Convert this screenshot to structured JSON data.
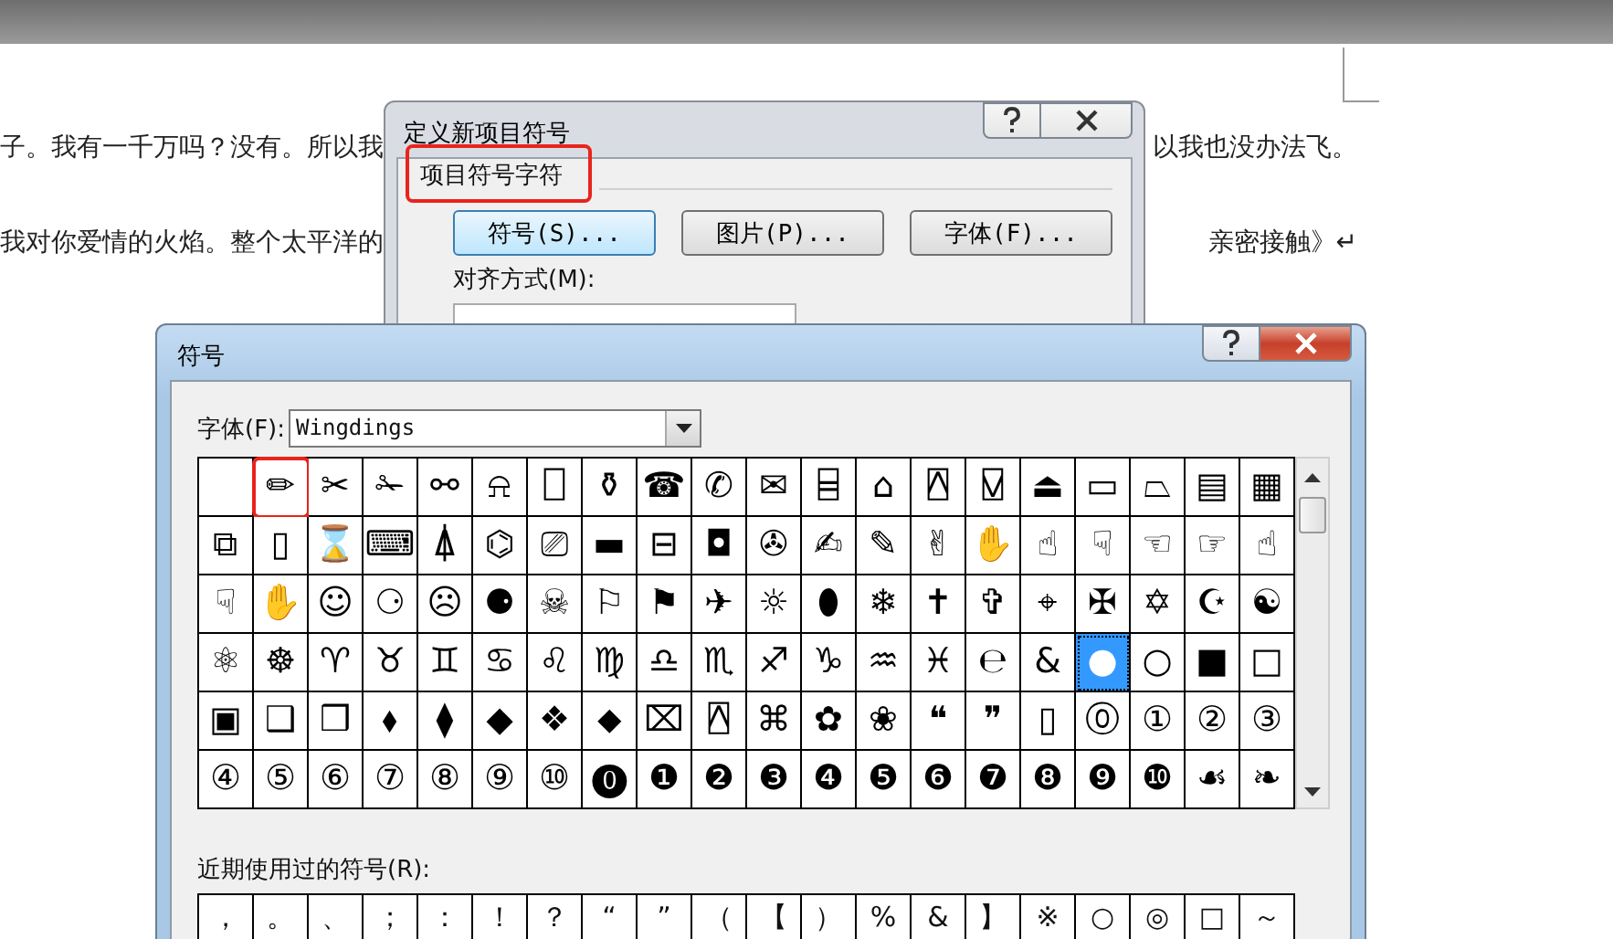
{
  "document": {
    "lines": [
      {
        "left": "子。我有一千万吗？没有。所以我",
        "right": "以我也没办法飞。"
      },
      {
        "left": "我对你爱情的火焰。整个太平洋的",
        "right": "亲密接触》↵"
      }
    ]
  },
  "bullet_dialog": {
    "title": "定义新项目符号",
    "group_label": "项目符号字符",
    "group_marked": true,
    "buttons": [
      "符号(S)...",
      "图片(P)...",
      "字体(F)..."
    ],
    "align_label": "对齐方式(M):"
  },
  "symbol_dialog": {
    "title": "符号",
    "font_label": "字体(F):",
    "font_value": "Wingdings",
    "rows": [
      [
        {
          "selected": false,
          "marked": false
        },
        {
          "s": "✏",
          "selected": false,
          "marked": true
        },
        {
          "s": "✂",
          "selected": false,
          "marked": false
        },
        {
          "s": "✁",
          "selected": false,
          "marked": false
        },
        {
          "s": "⚯",
          "selected": false,
          "marked": false
        },
        {
          "s": "⍾",
          "selected": false,
          "marked": false
        },
        {
          "s": "⎕",
          "selected": false,
          "marked": false
        },
        {
          "s": "⚱",
          "selected": false,
          "marked": false
        },
        {
          "s": "☎",
          "selected": false,
          "marked": false
        },
        {
          "s": "✆",
          "selected": false,
          "marked": false
        },
        {
          "s": "✉",
          "selected": false,
          "marked": false
        },
        {
          "s": "⌸",
          "selected": false,
          "marked": false
        },
        {
          "s": "⌂",
          "selected": false,
          "marked": false
        },
        {
          "s": "⍓",
          "selected": false,
          "marked": false
        },
        {
          "s": "⍌",
          "selected": false,
          "marked": false
        },
        {
          "s": "⏏",
          "selected": false,
          "marked": false
        },
        {
          "s": "▭",
          "selected": false,
          "marked": false
        },
        {
          "s": "⏢",
          "selected": false,
          "marked": false
        },
        {
          "s": "▤",
          "selected": false,
          "marked": false
        },
        {
          "s": "▦",
          "selected": false,
          "marked": false
        }
      ],
      [
        {
          "s": "⧉",
          "selected": false,
          "marked": false
        },
        {
          "s": "▯",
          "selected": false,
          "marked": false
        },
        {
          "s": "⌛",
          "selected": false,
          "marked": false
        },
        {
          "s": "⌨",
          "selected": false,
          "marked": false
        },
        {
          "s": "⍋",
          "selected": false,
          "marked": false
        },
        {
          "s": "⌬",
          "selected": false,
          "marked": false
        },
        {
          "s": "⎚",
          "selected": false,
          "marked": false
        },
        {
          "s": "▬",
          "selected": false,
          "marked": false
        },
        {
          "s": "⊟",
          "selected": false,
          "marked": false
        },
        {
          "s": "◘",
          "selected": false,
          "marked": false
        },
        {
          "s": "✇",
          "selected": false,
          "marked": false
        },
        {
          "s": "✍",
          "selected": false,
          "marked": false
        },
        {
          "s": "✎",
          "selected": false,
          "marked": false
        },
        {
          "s": "✌",
          "selected": false,
          "marked": false
        },
        {
          "s": "✋",
          "selected": false,
          "marked": false
        },
        {
          "s": "☝",
          "selected": false,
          "marked": false
        },
        {
          "s": "☟",
          "selected": false,
          "marked": false
        },
        {
          "s": "☜",
          "selected": false,
          "marked": false
        },
        {
          "s": "☞",
          "selected": false,
          "marked": false
        },
        {
          "s": "☝",
          "selected": false,
          "marked": false
        }
      ],
      [
        {
          "s": "☟",
          "selected": false,
          "marked": false
        },
        {
          "s": "✋",
          "selected": false,
          "marked": false
        },
        {
          "s": "☺",
          "selected": false,
          "marked": false
        },
        {
          "s": "⚆",
          "selected": false,
          "marked": false
        },
        {
          "s": "☹",
          "selected": false,
          "marked": false
        },
        {
          "s": "⚈",
          "selected": false,
          "marked": false
        },
        {
          "s": "☠",
          "selected": false,
          "marked": false
        },
        {
          "s": "⚐",
          "selected": false,
          "marked": false
        },
        {
          "s": "⚑",
          "selected": false,
          "marked": false
        },
        {
          "s": "✈",
          "selected": false,
          "marked": false
        },
        {
          "s": "☼",
          "selected": false,
          "marked": false
        },
        {
          "s": "⬮",
          "selected": false,
          "marked": false
        },
        {
          "s": "❄",
          "selected": false,
          "marked": false
        },
        {
          "s": "✝",
          "selected": false,
          "marked": false
        },
        {
          "s": "✞",
          "selected": false,
          "marked": false
        },
        {
          "s": "⌖",
          "selected": false,
          "marked": false
        },
        {
          "s": "✠",
          "selected": false,
          "marked": false
        },
        {
          "s": "✡",
          "selected": false,
          "marked": false
        },
        {
          "s": "☪",
          "selected": false,
          "marked": false
        },
        {
          "s": "☯",
          "selected": false,
          "marked": false
        }
      ],
      [
        {
          "s": "⚛",
          "selected": false,
          "marked": false
        },
        {
          "s": "☸",
          "selected": false,
          "marked": false
        },
        {
          "s": "♈",
          "selected": false,
          "marked": false
        },
        {
          "s": "♉",
          "selected": false,
          "marked": false
        },
        {
          "s": "♊",
          "selected": false,
          "marked": false
        },
        {
          "s": "♋",
          "selected": false,
          "marked": false
        },
        {
          "s": "♌",
          "selected": false,
          "marked": false
        },
        {
          "s": "♍",
          "selected": false,
          "marked": false
        },
        {
          "s": "♎",
          "selected": false,
          "marked": false
        },
        {
          "s": "♏",
          "selected": false,
          "marked": false
        },
        {
          "s": "♐",
          "selected": false,
          "marked": false
        },
        {
          "s": "♑",
          "selected": false,
          "marked": false
        },
        {
          "s": "♒",
          "selected": false,
          "marked": false
        },
        {
          "s": "♓",
          "selected": false,
          "marked": false
        },
        {
          "s": "℮",
          "selected": false,
          "marked": false
        },
        {
          "s": "&",
          "selected": false,
          "marked": false
        },
        {
          "s": "●",
          "selected": true,
          "marked": false
        },
        {
          "s": "○",
          "selected": false,
          "marked": false
        },
        {
          "s": "■",
          "selected": false,
          "marked": false
        },
        {
          "s": "□",
          "selected": false,
          "marked": false
        }
      ],
      [
        {
          "s": "▣",
          "selected": false,
          "marked": false
        },
        {
          "s": "❑",
          "selected": false,
          "marked": false
        },
        {
          "s": "❒",
          "selected": false,
          "marked": false
        },
        {
          "s": "⬧",
          "selected": false,
          "marked": false
        },
        {
          "s": "⧫",
          "selected": false,
          "marked": false
        },
        {
          "s": "◆",
          "selected": false,
          "marked": false
        },
        {
          "s": "❖",
          "selected": false,
          "marked": false
        },
        {
          "s": "⬥",
          "selected": false,
          "marked": false
        },
        {
          "s": "⌧",
          "selected": false,
          "marked": false
        },
        {
          "s": "⍓",
          "selected": false,
          "marked": false
        },
        {
          "s": "⌘",
          "selected": false,
          "marked": false
        },
        {
          "s": "✿",
          "selected": false,
          "marked": false
        },
        {
          "s": "❀",
          "selected": false,
          "marked": false
        },
        {
          "s": "❝",
          "selected": false,
          "marked": false
        },
        {
          "s": "❞",
          "selected": false,
          "marked": false
        },
        {
          "s": "▯",
          "selected": false,
          "marked": false
        },
        {
          "s": "⓪",
          "selected": false,
          "marked": false
        },
        {
          "s": "①",
          "selected": false,
          "marked": false
        },
        {
          "s": "②",
          "selected": false,
          "marked": false
        },
        {
          "s": "③",
          "selected": false,
          "marked": false
        }
      ],
      [
        {
          "s": "④",
          "selected": false,
          "marked": false
        },
        {
          "s": "⑤",
          "selected": false,
          "marked": false
        },
        {
          "s": "⑥",
          "selected": false,
          "marked": false
        },
        {
          "s": "⑦",
          "selected": false,
          "marked": false
        },
        {
          "s": "⑧",
          "selected": false,
          "marked": false
        },
        {
          "s": "⑨",
          "selected": false,
          "marked": false
        },
        {
          "s": "⑩",
          "selected": false,
          "marked": false
        },
        {
          "s": "⓿",
          "selected": false,
          "marked": false
        },
        {
          "s": "❶",
          "selected": false,
          "marked": false
        },
        {
          "s": "❷",
          "selected": false,
          "marked": false
        },
        {
          "s": "❸",
          "selected": false,
          "marked": false
        },
        {
          "s": "❹",
          "selected": false,
          "marked": false
        },
        {
          "s": "❺",
          "selected": false,
          "marked": false
        },
        {
          "s": "❻",
          "selected": false,
          "marked": false
        },
        {
          "s": "❼",
          "selected": false,
          "marked": false
        },
        {
          "s": "❽",
          "selected": false,
          "marked": false
        },
        {
          "s": "❾",
          "selected": false,
          "marked": false
        },
        {
          "s": "❿",
          "selected": false,
          "marked": false
        },
        {
          "s": "☙",
          "selected": false,
          "marked": false
        },
        {
          "s": "❧",
          "selected": false,
          "marked": false
        }
      ]
    ],
    "recent_label": "近期使用过的符号(R):",
    "recent": [
      "，",
      "。",
      "、",
      "；",
      "：",
      "！",
      "？",
      "“",
      "”",
      "（",
      "【",
      "）",
      "%",
      "&",
      "】",
      "※",
      "○",
      "◎",
      "□",
      "～"
    ]
  }
}
